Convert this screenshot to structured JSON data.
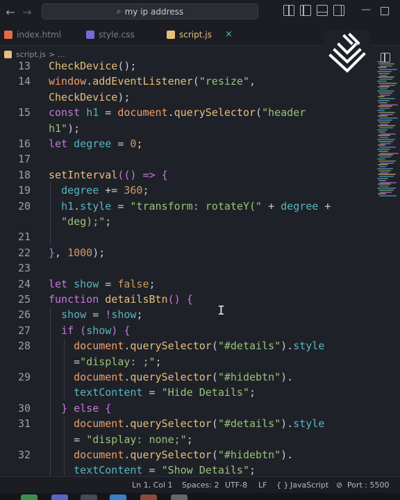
{
  "titlebar": {
    "search_text": "my ip address"
  },
  "tabs": [
    {
      "label": "index.html"
    },
    {
      "label": "style.css"
    },
    {
      "label": "script.js",
      "close": "×"
    }
  ],
  "breadcrumb": {
    "file": "script.js",
    "sep": ">",
    "more": "..."
  },
  "code_lines": [
    {
      "num": "13",
      "html": "<span class='o'>CheckDevice</span><span class='c'>();</span>"
    },
    {
      "num": "14",
      "html": "<span class='p'>window</span><span class='c'>.</span><span class='o'>addEventListener</span><span class='c'>(</span><span class='s'>\"resize\"</span><span class='c'>,</span>"
    },
    {
      "num": "",
      "html": "<span class='o'>CheckDevice</span><span class='c'>);</span>"
    },
    {
      "num": "15",
      "html": "<span class='k'>const</span> <span class='cy'>h1</span> <span class='c'>=</span> <span class='p'>document</span><span class='c'>.</span><span class='o'>querySelector</span><span class='c'>(</span><span class='s'>\"header</span>"
    },
    {
      "num": "",
      "html": "<span class='s'>h1\"</span><span class='c'>);</span>"
    },
    {
      "num": "16",
      "html": "<span class='k'>let</span> <span class='cy'>degree</span> <span class='c'>=</span> <span class='b'>0</span><span class='c'>;</span>"
    },
    {
      "num": "17",
      "html": ""
    },
    {
      "num": "18",
      "html": "<span class='o'>setInterval</span><span class='pu'>(()</span> <span class='k'>=&gt;</span> <span class='pu'>{</span>"
    },
    {
      "num": "19",
      "html": "  <span class='cy'>degree</span> <span class='c'>+=</span> <span class='b'>360</span><span class='c'>;</span>"
    },
    {
      "num": "20",
      "html": "  <span class='cy'>h1</span><span class='c'>.</span><span class='cy'>style</span> <span class='c'>=</span> <span class='s'>\"transform: rotateY(\"</span> <span class='c'>+</span> <span class='cy'>degree</span> <span class='c'>+</span>"
    },
    {
      "num": "",
      "html": "  <span class='s'>\"deg);\"</span><span class='c'>;</span>"
    },
    {
      "num": "21",
      "html": ""
    },
    {
      "num": "22",
      "html": "<span class='pu'>}</span><span class='c'>,</span> <span class='b'>1000</span><span class='c'>);</span>"
    },
    {
      "num": "23",
      "html": ""
    },
    {
      "num": "24",
      "html": "<span class='k'>let</span> <span class='cy'>show</span> <span class='c'>=</span> <span class='b'>false</span><span class='c'>;</span>"
    },
    {
      "num": "25",
      "html": "<span class='k'>function</span> <span class='o'>detailsBtn</span><span class='pu'>()</span> <span class='pu'>{</span>"
    },
    {
      "num": "26",
      "html": "  <span class='cy'>show</span> <span class='c'>=</span> <span class='k'>!</span><span class='cy'>show</span><span class='c'>;</span>"
    },
    {
      "num": "27",
      "html": "  <span class='k'>if</span> <span class='pu'>(</span><span class='cy'>show</span><span class='pu'>)</span> <span class='pu'>{</span>"
    },
    {
      "num": "28",
      "html": "    <span class='p'>document</span><span class='c'>.</span><span class='o'>querySelector</span><span class='c'>(</span><span class='s'>\"#details\"</span><span class='c'>).</span><span class='cy'>style</span>"
    },
    {
      "num": "",
      "html": "    <span class='c'>=</span><span class='s'>\"display: ;\"</span><span class='c'>;</span>"
    },
    {
      "num": "29",
      "html": "    <span class='p'>document</span><span class='c'>.</span><span class='o'>querySelector</span><span class='c'>(</span><span class='s'>\"#hidebtn\"</span><span class='c'>).</span>"
    },
    {
      "num": "",
      "html": "    <span class='cy'>textContent</span> <span class='c'>=</span> <span class='s'>\"Hide Details\"</span><span class='c'>;</span>"
    },
    {
      "num": "30",
      "html": "  <span class='pu'>}</span> <span class='k'>else</span> <span class='pu'>{</span>"
    },
    {
      "num": "31",
      "html": "    <span class='p'>document</span><span class='c'>.</span><span class='o'>querySelector</span><span class='c'>(</span><span class='s'>\"#details\"</span><span class='c'>).</span><span class='cy'>style</span>"
    },
    {
      "num": "",
      "html": "    <span class='c'>=</span> <span class='s'>\"display: none;\"</span><span class='c'>;</span>"
    },
    {
      "num": "32",
      "html": "    <span class='p'>document</span><span class='c'>.</span><span class='o'>querySelector</span><span class='c'>(</span><span class='s'>\"#hidebtn\"</span><span class='c'>).</span>"
    },
    {
      "num": "",
      "html": "    <span class='cy'>textContent</span> <span class='c'>=</span> <span class='s'>\"Show Details\"</span><span class='c'>;</span>"
    }
  ],
  "statusbar": {
    "position": "Ln 1, Col 1",
    "spaces": "Spaces: 2",
    "encoding": "UTF-8",
    "eol": "LF",
    "lang_icon": "{ }",
    "language": "JavaScript",
    "port": "Port : 5500"
  },
  "colors": {
    "background": "#1f2128",
    "keyword": "#c678dd",
    "function": "#e5c07b",
    "string": "#98c379",
    "variable": "#56b6c2",
    "number": "#d19a66",
    "accent_tab": "#e5c07b"
  },
  "icons": {
    "back": "arrow-left-icon",
    "forward": "arrow-right-icon",
    "search": "search-icon",
    "logo": "layered-chevron-logo"
  }
}
